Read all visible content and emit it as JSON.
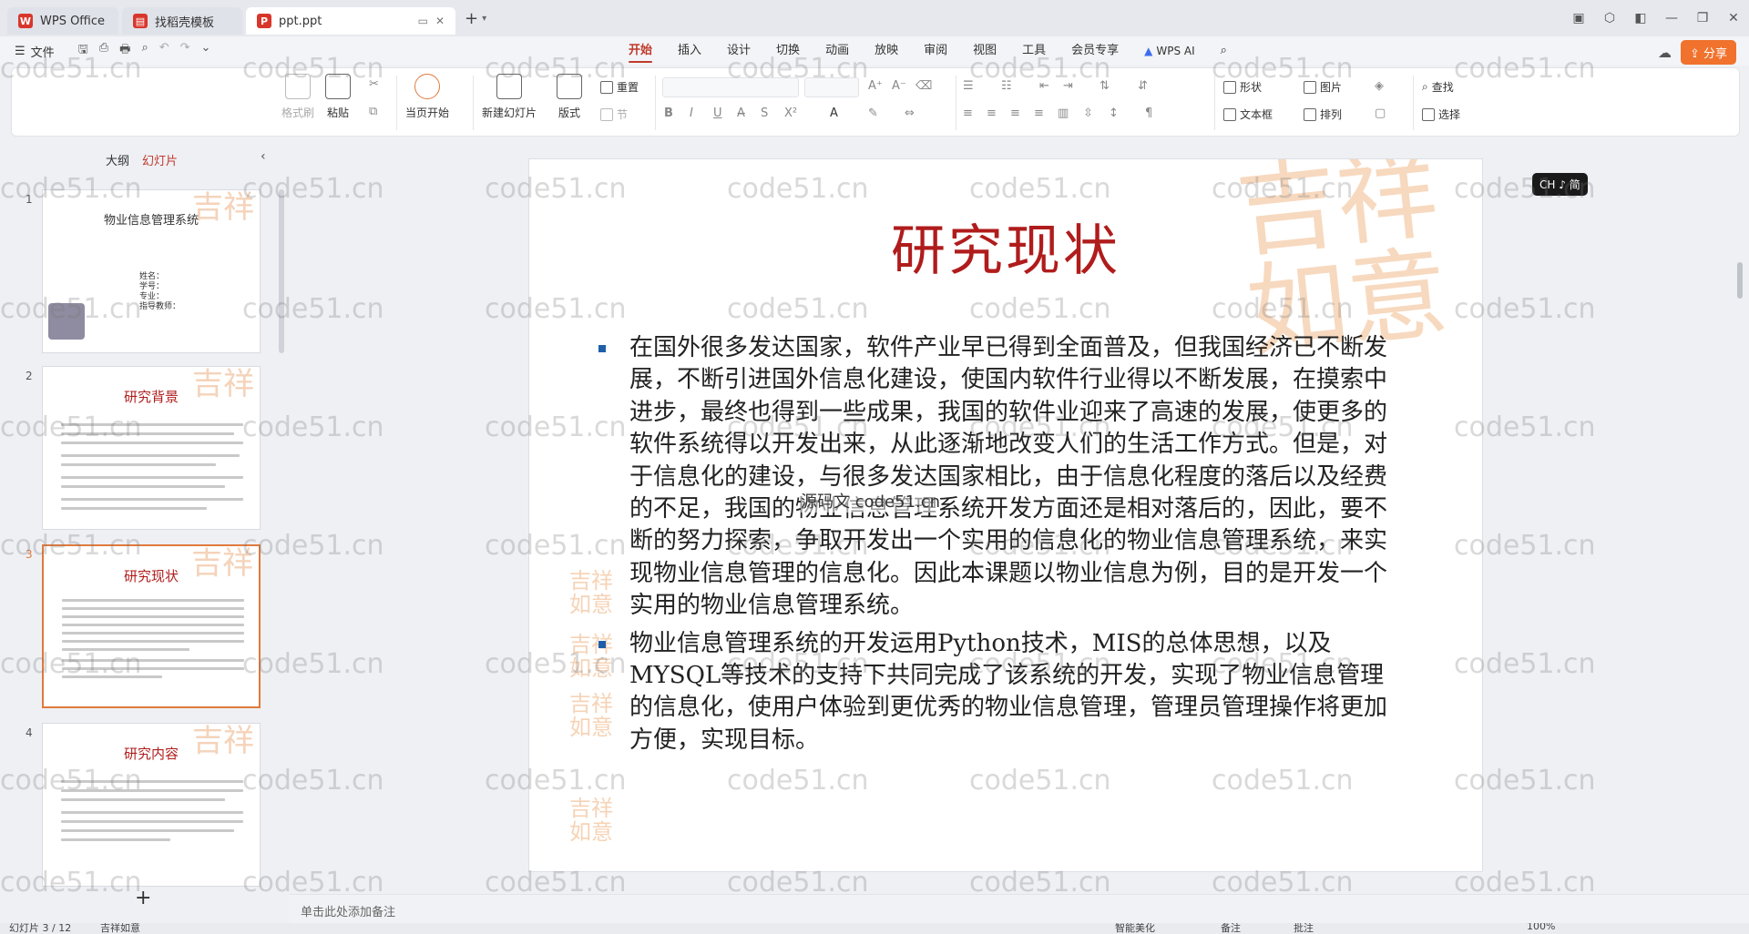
{
  "tabs": [
    {
      "label": "WPS Office"
    },
    {
      "label": "找稻壳模板"
    },
    {
      "label": "ppt.ppt"
    }
  ],
  "menu": {
    "file": "文件",
    "tabs": [
      "开始",
      "插入",
      "设计",
      "切换",
      "动画",
      "放映",
      "审阅",
      "视图",
      "工具",
      "会员专享"
    ],
    "active_tab": "开始",
    "wps_ai": "WPS AI",
    "share": "分享"
  },
  "ribbon": {
    "format_painter": "格式刷",
    "paste": "粘贴",
    "play_from_current": "当页开始",
    "new_slide": "新建幻灯片",
    "layout": "版式",
    "reset": "重置",
    "section": "节",
    "shape": "形状",
    "picture": "图片",
    "textbox": "文本框",
    "arrange": "排列",
    "find": "查找",
    "select": "选择"
  },
  "left_panel": {
    "tab_outline": "大纲",
    "tab_slides": "幻灯片",
    "slides": [
      {
        "num": "1",
        "title": "物业信息管理系统",
        "fields": [
          "姓名：",
          "学号：",
          "专业：",
          "指导教师："
        ]
      },
      {
        "num": "2",
        "title": "研究背景"
      },
      {
        "num": "3",
        "title": "研究现状"
      },
      {
        "num": "4",
        "title": "研究内容"
      }
    ]
  },
  "slide": {
    "title": "研究现状",
    "bullets": [
      "在国外很多发达国家，软件产业早已得到全面普及，但我国经济已不断发展，不断引进国外信息化建设，使国内软件行业得以不断发展，在摸索中进步，最终也得到一些成果，我国的软件业迎来了高速的发展，使更多的软件系统得以开发出来，从此逐渐地改变人们的生活工作方式。但是，对于信息化的建设，与很多发达国家相比，由于信息化程度的落后以及经费的不足，我国的物业信息管理系统开发方面还是相对落后的，因此，要不断的努力探索，争取开发出一个实用的信息化的物业信息管理系统，来实现物业信息管理的信息化。因此本课题以物业信息为例，目的是开发一个实用的物业信息管理系统。",
      "物业信息管理系统的开发运用Python技术，MIS的总体思想，以及MYSQL等技术的支持下共同完成了该系统的开发，实现了物业信息管理的信息化，使用户体验到更优秀的物业信息管理，管理员管理操作将更加方便，实现目标。"
    ],
    "overlay_text": "源码文 code51.cn"
  },
  "ime": "CH ♪ 简",
  "notes_placeholder": "单击此处添加备注",
  "status": {
    "slide_info": "幻灯片 3 / 12",
    "theme": "吉祥如意",
    "smart_beautify": "智能美化",
    "notes": "备注",
    "comments": "批注",
    "zoom": "100%"
  },
  "watermark": "code51.cn"
}
